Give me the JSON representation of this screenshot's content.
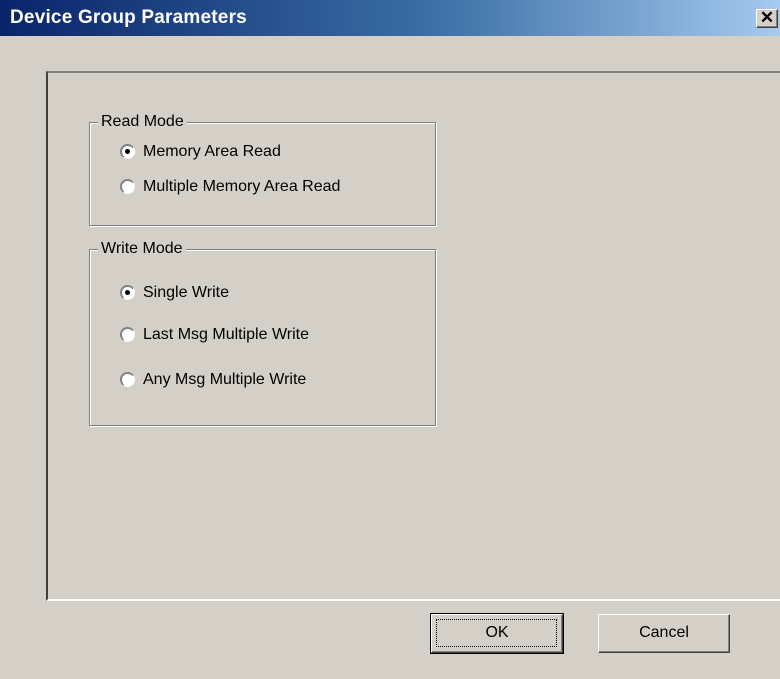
{
  "window": {
    "title": "Device Group Parameters",
    "close_symbol": "✕",
    "close_icon": "close-icon"
  },
  "read_mode": {
    "legend": "Read Mode",
    "options": [
      {
        "label": "Memory Area Read",
        "selected": true
      },
      {
        "label": "Multiple Memory Area Read",
        "selected": false
      }
    ]
  },
  "write_mode": {
    "legend": "Write Mode",
    "options": [
      {
        "label": "Single Write",
        "selected": true
      },
      {
        "label": "Last Msg Multiple Write",
        "selected": false
      },
      {
        "label": "Any Msg Multiple Write",
        "selected": false
      }
    ]
  },
  "buttons": {
    "ok": "OK",
    "cancel": "Cancel"
  }
}
